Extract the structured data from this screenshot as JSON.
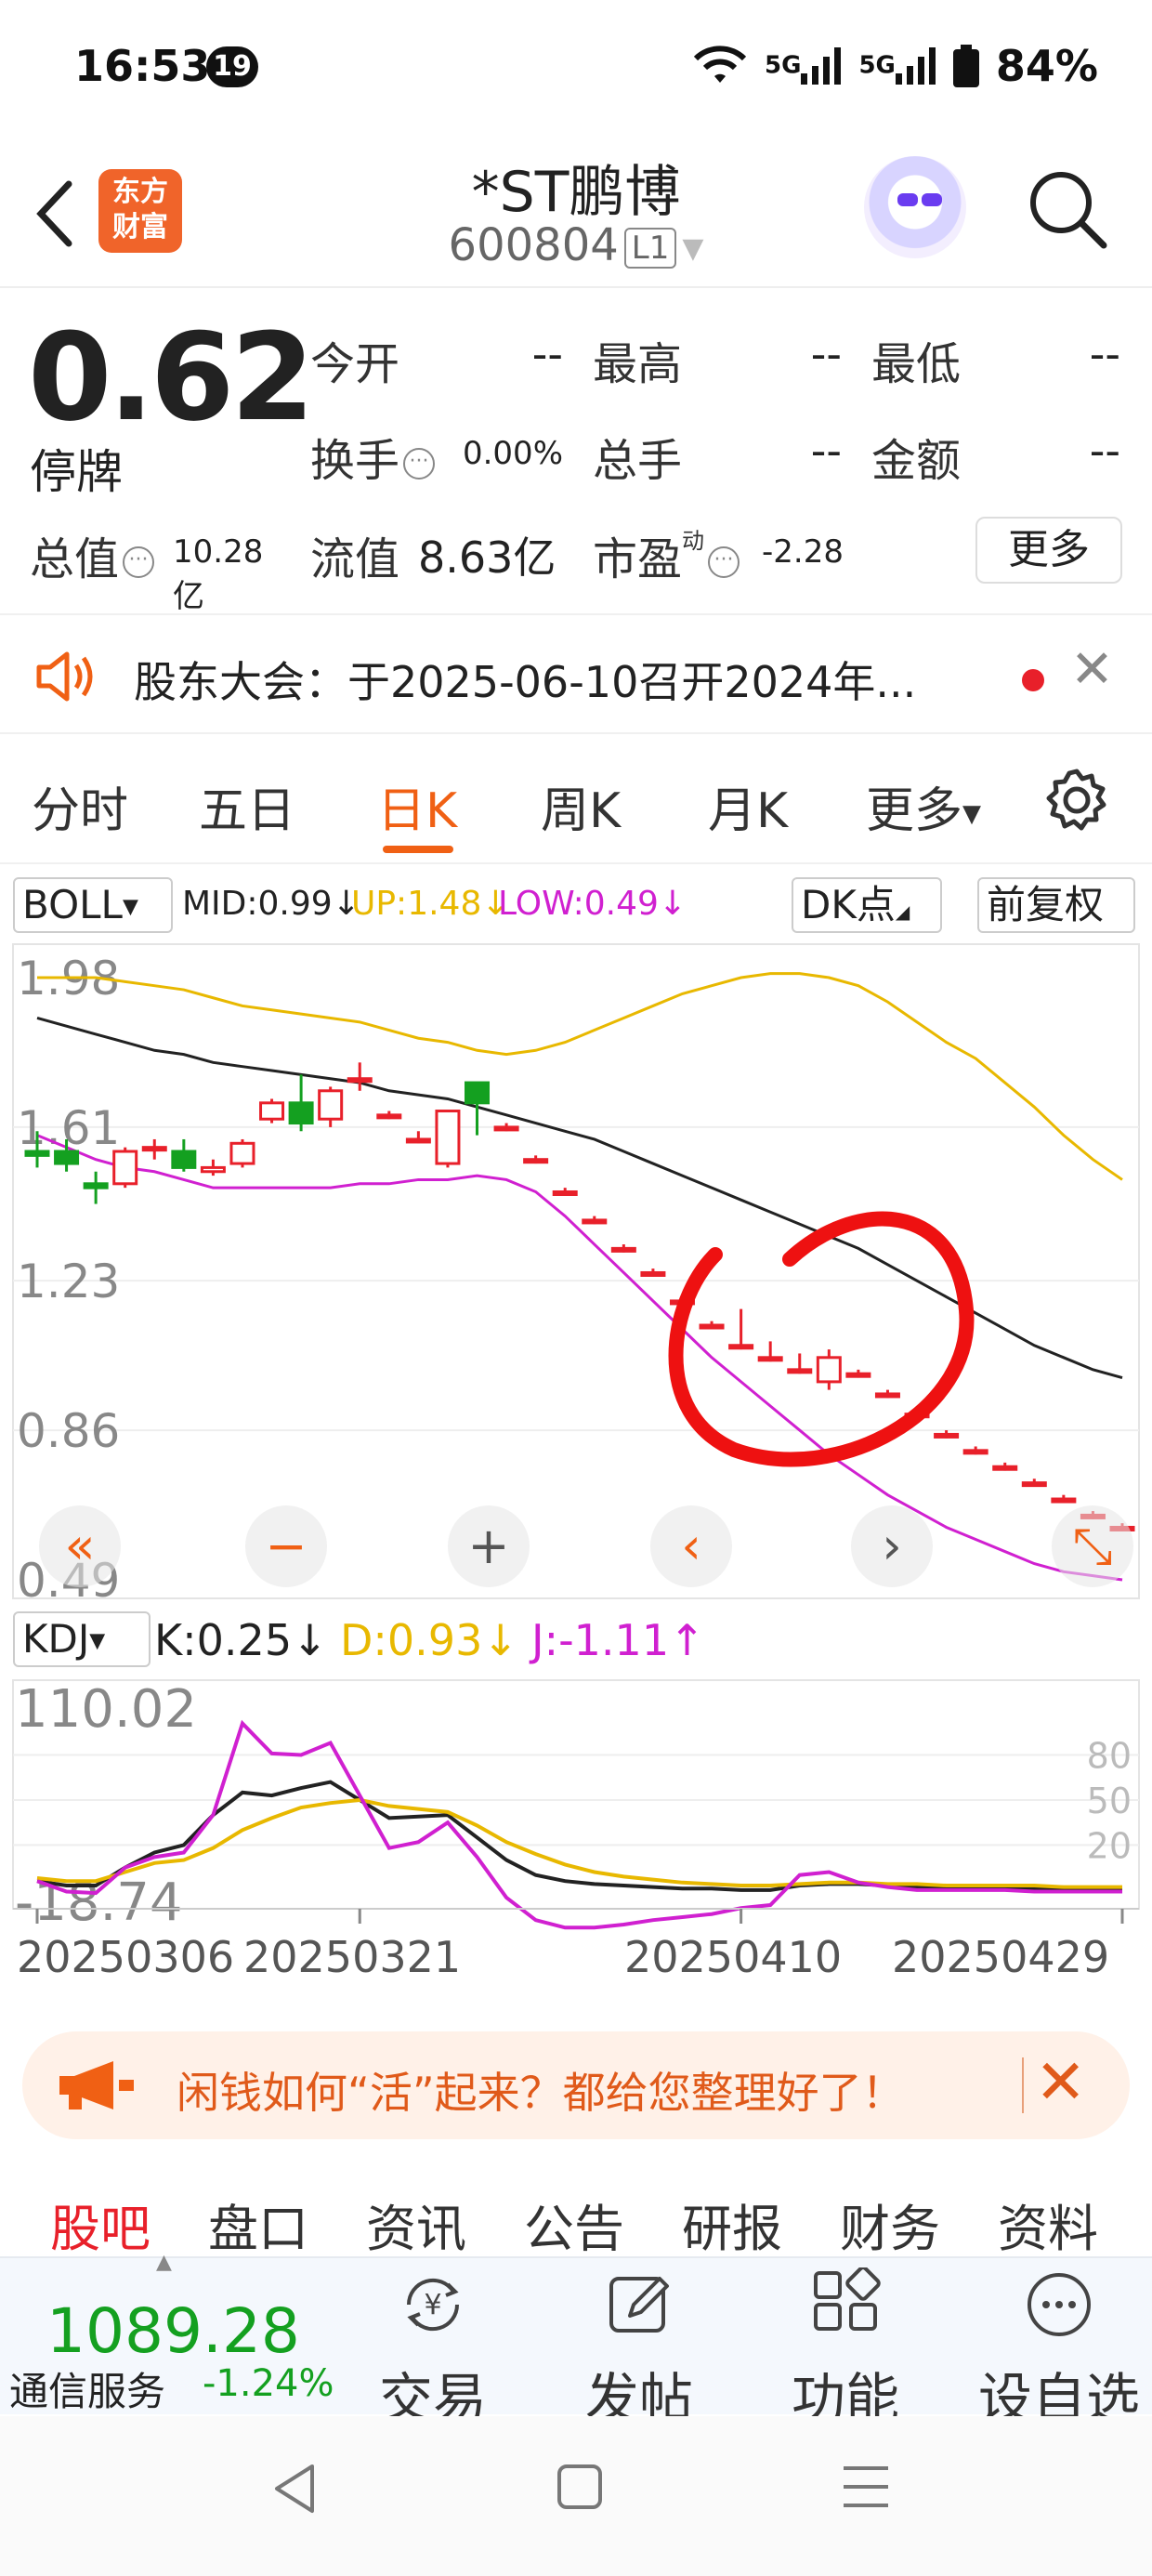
{
  "status_bar": {
    "time": "16:53",
    "notification_count": "19",
    "network_1": "5G",
    "network_2": "5G",
    "battery": "84%"
  },
  "header": {
    "logo_line1": "东方",
    "logo_line2": "财富",
    "stock_name": "*ST鹏博",
    "stock_code": "600804",
    "level_badge": "L1"
  },
  "quote": {
    "price": "0.62",
    "status": "停牌",
    "fields": [
      {
        "label": "今开",
        "value": "--"
      },
      {
        "label": "最高",
        "value": "--"
      },
      {
        "label": "最低",
        "value": "--"
      },
      {
        "label": "换手",
        "value": "0.00%"
      },
      {
        "label": "总手",
        "value": "--"
      },
      {
        "label": "金额",
        "value": "--"
      },
      {
        "label": "总值",
        "value": "10.28亿"
      },
      {
        "label": "流值",
        "value": "8.63亿"
      },
      {
        "label": "市盈",
        "value": "-2.28",
        "superscript": "动"
      }
    ],
    "more_label": "更多"
  },
  "announcement": {
    "text": "股东大会：于2025-06-10召开2024年..."
  },
  "period_tabs": [
    {
      "label": "分时",
      "active": false
    },
    {
      "label": "五日",
      "active": false
    },
    {
      "label": "日K",
      "active": true
    },
    {
      "label": "周K",
      "active": false
    },
    {
      "label": "月K",
      "active": false
    },
    {
      "label": "更多",
      "active": false
    }
  ],
  "indicators": {
    "boll_name": "BOLL",
    "mid": "MID:0.99↓",
    "up": "UP:1.48↓",
    "low": "LOW:0.49↓",
    "dk_label": "DK点",
    "adjust_label": "前复权",
    "kdj_name": "KDJ",
    "k": "K:0.25↓",
    "d": "D:0.93↓",
    "j": "J:-1.11↑"
  },
  "chart_data": [
    {
      "type": "candlestick",
      "title": "",
      "ylim": [
        0.49,
        1.98
      ],
      "y_ticks": [
        "1.98",
        "1.61",
        "1.23",
        "0.86",
        "0.49"
      ],
      "colors": {
        "up": "#e8202a",
        "down": "#14a020",
        "mid": "#222222",
        "upper": "#e8b800",
        "lower": "#d020d0",
        "annotation": "#ee1111"
      },
      "candles": [
        {
          "o": 1.55,
          "h": 1.6,
          "l": 1.51,
          "c": 1.54
        },
        {
          "o": 1.55,
          "h": 1.58,
          "l": 1.5,
          "c": 1.52
        },
        {
          "o": 1.47,
          "h": 1.5,
          "l": 1.42,
          "c": 1.46
        },
        {
          "o": 1.47,
          "h": 1.56,
          "l": 1.46,
          "c": 1.55
        },
        {
          "o": 1.56,
          "h": 1.58,
          "l": 1.53,
          "c": 1.56
        },
        {
          "o": 1.55,
          "h": 1.58,
          "l": 1.5,
          "c": 1.51
        },
        {
          "o": 1.5,
          "h": 1.53,
          "l": 1.49,
          "c": 1.51
        },
        {
          "o": 1.52,
          "h": 1.58,
          "l": 1.51,
          "c": 1.57
        },
        {
          "o": 1.63,
          "h": 1.68,
          "l": 1.62,
          "c": 1.67
        },
        {
          "o": 1.67,
          "h": 1.74,
          "l": 1.6,
          "c": 1.62
        },
        {
          "o": 1.63,
          "h": 1.71,
          "l": 1.61,
          "c": 1.7
        },
        {
          "o": 1.73,
          "h": 1.77,
          "l": 1.7,
          "c": 1.73
        },
        {
          "o": 1.64,
          "h": 1.65,
          "l": 1.63,
          "c": 1.64
        },
        {
          "o": 1.58,
          "h": 1.6,
          "l": 1.57,
          "c": 1.58
        },
        {
          "o": 1.52,
          "h": 1.65,
          "l": 1.51,
          "c": 1.65
        },
        {
          "o": 1.72,
          "h": 1.72,
          "l": 1.59,
          "c": 1.67
        },
        {
          "o": 1.61,
          "h": 1.62,
          "l": 1.6,
          "c": 1.61
        },
        {
          "o": 1.53,
          "h": 1.54,
          "l": 1.52,
          "c": 1.53
        },
        {
          "o": 1.45,
          "h": 1.46,
          "l": 1.44,
          "c": 1.45
        },
        {
          "o": 1.38,
          "h": 1.39,
          "l": 1.37,
          "c": 1.38
        },
        {
          "o": 1.31,
          "h": 1.32,
          "l": 1.3,
          "c": 1.31
        },
        {
          "o": 1.25,
          "h": 1.26,
          "l": 1.24,
          "c": 1.25
        },
        {
          "o": 1.18,
          "h": 1.19,
          "l": 1.17,
          "c": 1.18
        },
        {
          "o": 1.12,
          "h": 1.13,
          "l": 1.11,
          "c": 1.12
        },
        {
          "o": 1.07,
          "h": 1.16,
          "l": 1.06,
          "c": 1.07
        },
        {
          "o": 1.04,
          "h": 1.08,
          "l": 1.03,
          "c": 1.04
        },
        {
          "o": 1.01,
          "h": 1.05,
          "l": 1.0,
          "c": 1.01
        },
        {
          "o": 0.98,
          "h": 1.06,
          "l": 0.96,
          "c": 1.04
        },
        {
          "o": 1.0,
          "h": 1.01,
          "l": 0.99,
          "c": 1.0
        },
        {
          "o": 0.95,
          "h": 0.96,
          "l": 0.94,
          "c": 0.95
        },
        {
          "o": 0.9,
          "h": 0.91,
          "l": 0.89,
          "c": 0.9
        },
        {
          "o": 0.85,
          "h": 0.86,
          "l": 0.84,
          "c": 0.85
        },
        {
          "o": 0.81,
          "h": 0.82,
          "l": 0.8,
          "c": 0.81
        },
        {
          "o": 0.77,
          "h": 0.78,
          "l": 0.76,
          "c": 0.77
        },
        {
          "o": 0.73,
          "h": 0.74,
          "l": 0.72,
          "c": 0.73
        },
        {
          "o": 0.69,
          "h": 0.7,
          "l": 0.68,
          "c": 0.69
        },
        {
          "o": 0.65,
          "h": 0.66,
          "l": 0.64,
          "c": 0.65
        },
        {
          "o": 0.62,
          "h": 0.63,
          "l": 0.61,
          "c": 0.62
        }
      ],
      "mid": [
        1.88,
        1.86,
        1.84,
        1.82,
        1.8,
        1.79,
        1.77,
        1.76,
        1.75,
        1.74,
        1.73,
        1.72,
        1.7,
        1.69,
        1.68,
        1.66,
        1.64,
        1.62,
        1.6,
        1.58,
        1.55,
        1.52,
        1.49,
        1.46,
        1.43,
        1.4,
        1.37,
        1.34,
        1.31,
        1.27,
        1.23,
        1.19,
        1.15,
        1.11,
        1.07,
        1.04,
        1.01,
        0.99
      ],
      "upper": [
        1.98,
        1.98,
        1.98,
        1.97,
        1.96,
        1.95,
        1.93,
        1.91,
        1.9,
        1.89,
        1.88,
        1.87,
        1.85,
        1.83,
        1.82,
        1.8,
        1.79,
        1.8,
        1.82,
        1.85,
        1.88,
        1.91,
        1.94,
        1.96,
        1.98,
        1.99,
        1.99,
        1.98,
        1.96,
        1.92,
        1.87,
        1.82,
        1.78,
        1.72,
        1.66,
        1.59,
        1.53,
        1.48
      ],
      "lower": [
        1.59,
        1.56,
        1.53,
        1.51,
        1.5,
        1.48,
        1.46,
        1.46,
        1.46,
        1.46,
        1.46,
        1.47,
        1.47,
        1.48,
        1.48,
        1.49,
        1.48,
        1.45,
        1.39,
        1.32,
        1.25,
        1.18,
        1.11,
        1.04,
        0.98,
        0.92,
        0.86,
        0.8,
        0.75,
        0.7,
        0.66,
        0.62,
        0.59,
        0.56,
        0.53,
        0.51,
        0.5,
        0.49
      ]
    },
    {
      "type": "line",
      "title": "",
      "ylim": [
        -18.74,
        110.02
      ],
      "y_ticks": [
        "110.02",
        "-18.74"
      ],
      "right_ticks": [
        "80",
        "50",
        "20"
      ],
      "x_tick_labels": [
        "20250306",
        "20250321",
        "20250410",
        "20250429"
      ],
      "series": [
        {
          "name": "K",
          "color": "#222222",
          "values": [
            -4,
            -7,
            -7,
            5,
            15,
            20,
            40,
            55,
            53,
            58,
            62,
            50,
            38,
            39,
            40,
            25,
            10,
            0,
            -4,
            -6,
            -7,
            -8,
            -9,
            -9,
            -10,
            -10,
            -7,
            -6,
            -6,
            -7,
            -8,
            -9,
            -9,
            -9,
            -9,
            -9,
            -9,
            -9
          ]
        },
        {
          "name": "D",
          "color": "#e8b800",
          "values": [
            -2,
            -4,
            -4,
            2,
            8,
            10,
            18,
            30,
            38,
            45,
            48,
            50,
            46,
            44,
            42,
            33,
            22,
            14,
            7,
            2,
            -1,
            -3,
            -5,
            -6,
            -7,
            -7,
            -6,
            -5,
            -5,
            -6,
            -6,
            -7,
            -7,
            -7,
            -7,
            -8,
            -8,
            -8
          ]
        },
        {
          "name": "J",
          "color": "#d020d0",
          "values": [
            -4,
            -11,
            -12,
            5,
            12,
            15,
            40,
            101,
            81,
            80,
            88,
            53,
            18,
            22,
            35,
            12,
            -15,
            -30,
            -35,
            -35,
            -33,
            -30,
            -28,
            -26,
            -22,
            -20,
            0,
            2,
            -5,
            -8,
            -10,
            -10,
            -10,
            -10,
            -11,
            -11,
            -11,
            -11
          ]
        }
      ]
    }
  ],
  "promo": {
    "text": "闲钱如何“活”起来？都给您整理好了！"
  },
  "section_tabs": [
    {
      "label": "股吧",
      "active": true
    },
    {
      "label": "盘口",
      "active": false
    },
    {
      "label": "资讯",
      "active": false
    },
    {
      "label": "公告",
      "active": false
    },
    {
      "label": "研报",
      "active": false
    },
    {
      "label": "财务",
      "active": false
    },
    {
      "label": "资料",
      "active": false
    }
  ],
  "toolbar": {
    "index_value": "1089.28",
    "index_name": "通信服务",
    "index_change": "-1.24%",
    "tools": [
      {
        "label": "交易",
        "icon": "trade-icon"
      },
      {
        "label": "发帖",
        "icon": "post-icon"
      },
      {
        "label": "功能",
        "icon": "apps-icon"
      },
      {
        "label": "设自选",
        "icon": "more-icon"
      }
    ]
  }
}
